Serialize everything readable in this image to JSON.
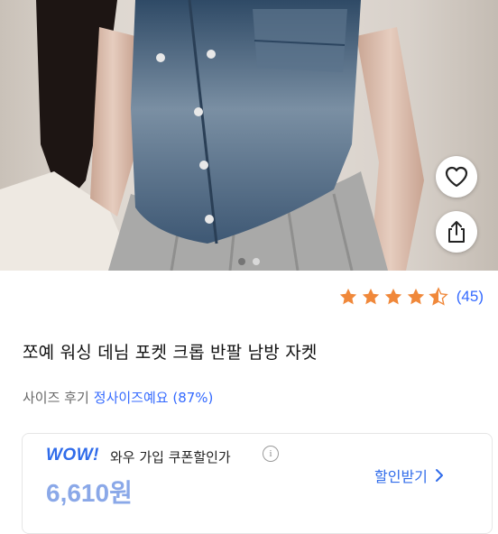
{
  "gallery": {
    "dots": [
      true,
      false
    ],
    "actions": {
      "favorite_icon": "heart-icon",
      "share_icon": "share-icon"
    }
  },
  "product": {
    "rating": 4.5,
    "rating_max": 5,
    "review_count": "(45)",
    "title": "쪼예 워싱 데님 포켓 크롭 반팔 남방 자켓",
    "size_review_label": "사이즈 후기",
    "size_review_value": "정사이즈예요 (87%)"
  },
  "wow": {
    "logo": "WOW!",
    "text": "와우 가입 쿠폰할인가",
    "price": "6,610원",
    "coupon_label": "할인받기",
    "colors": {
      "accent": "#2f6bea",
      "star": "#f0883a",
      "link": "#346aff"
    }
  }
}
